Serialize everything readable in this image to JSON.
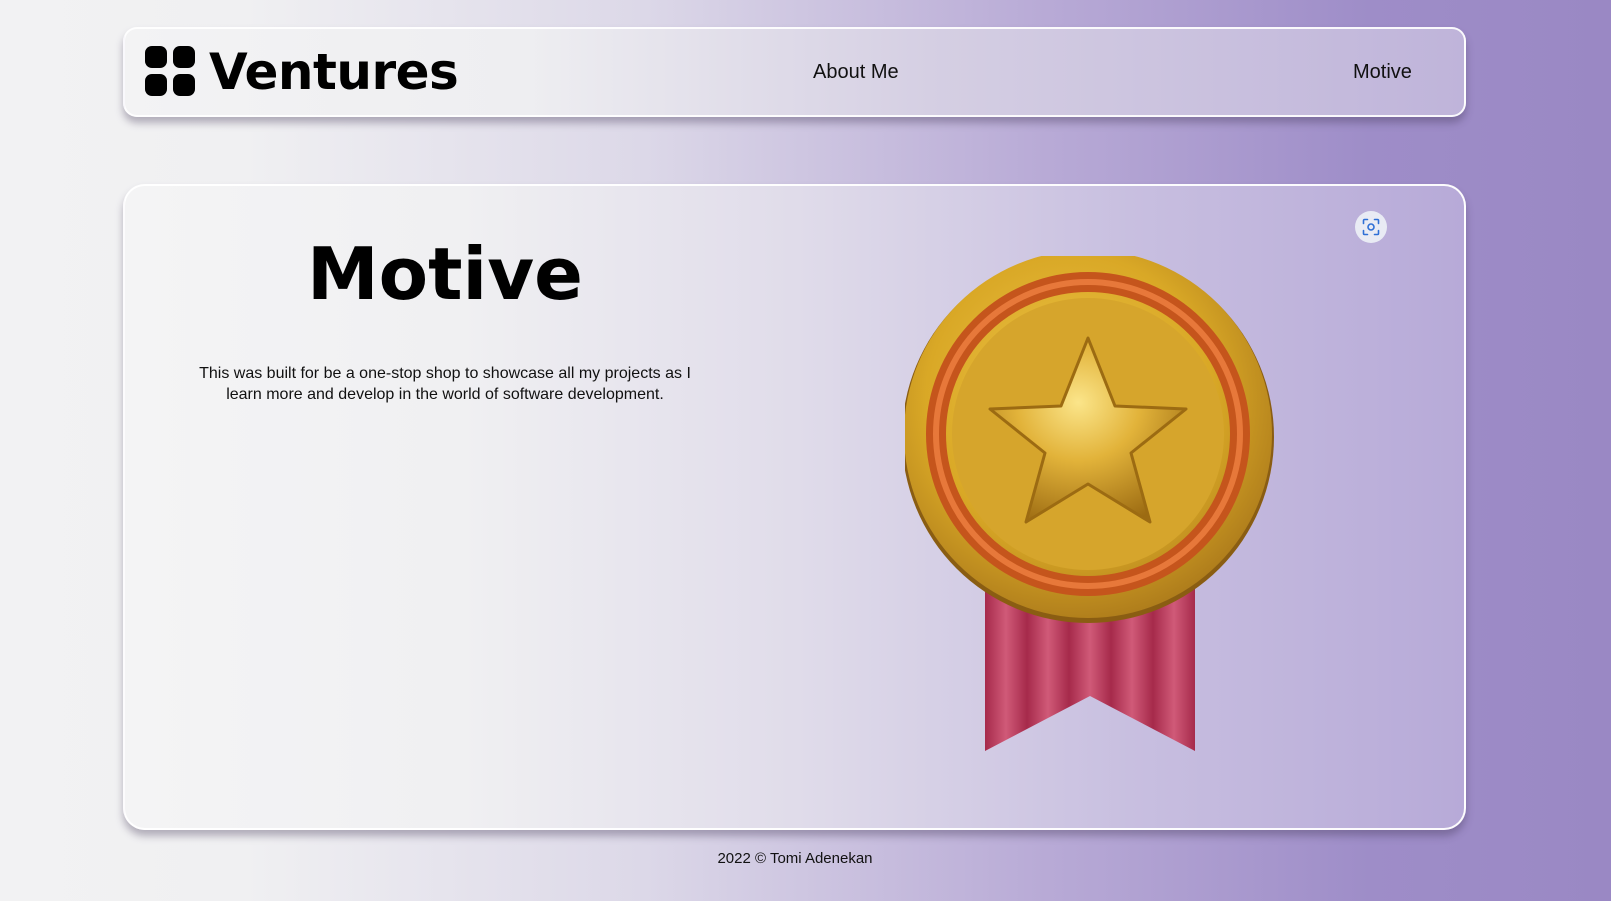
{
  "header": {
    "brand": "Ventures",
    "nav": [
      {
        "label": "About Me"
      },
      {
        "label": "Motive"
      }
    ]
  },
  "main": {
    "title": "Motive",
    "description": "This was built for be a one-stop shop to showcase all my projects as I learn more and develop in the world of software development.",
    "image": {
      "icon": "medal-star-icon"
    },
    "lens_button": {
      "icon": "visual-search-icon"
    }
  },
  "footer": {
    "text": "2022 © Tomi Adenekan"
  },
  "colors": {
    "gradient_left": "#f2f2f3",
    "gradient_right": "#9a88c4",
    "medal_gold": "#d8a625",
    "medal_ring": "#d9501a",
    "ribbon": "#b8385a"
  }
}
